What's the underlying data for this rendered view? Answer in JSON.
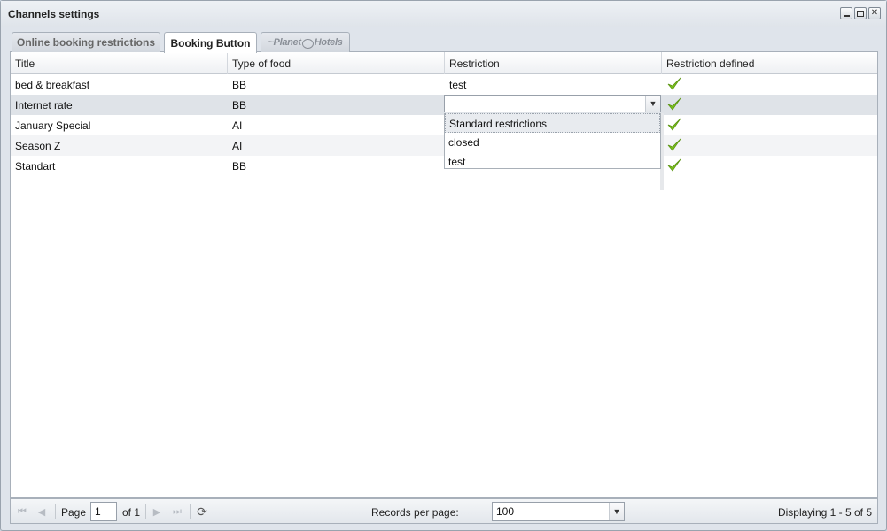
{
  "window": {
    "title": "Channels settings",
    "tools": [
      "minimize-icon",
      "maximize-icon",
      "close-icon"
    ]
  },
  "tabs": [
    {
      "label": "Online booking restrictions",
      "active": false
    },
    {
      "label": "Booking Button",
      "active": true
    },
    {
      "label_left": "~Planet",
      "label_right": "Hotels",
      "icon": "globe-icon",
      "disabled": true
    }
  ],
  "grid": {
    "columns": [
      "Title",
      "Type of food",
      "Restriction",
      "Restriction defined"
    ],
    "rows": [
      {
        "title": "bed & breakfast",
        "food": "BB",
        "restriction": "test",
        "defined": true
      },
      {
        "title": "Internet rate",
        "food": "BB",
        "restriction": "",
        "defined": true
      },
      {
        "title": "January Special",
        "food": "AI",
        "restriction": "",
        "defined": true
      },
      {
        "title": "Season Z",
        "food": "AI",
        "restriction": "",
        "defined": true
      },
      {
        "title": "Standart",
        "food": "BB",
        "restriction": "",
        "defined": true
      }
    ],
    "editor": {
      "value": "",
      "options": [
        "Standard restrictions",
        "closed",
        "test"
      ],
      "highlighted": "Standard restrictions"
    }
  },
  "pager": {
    "page_label": "Page",
    "page_value": "1",
    "of_label": "of 1",
    "records_label": "Records per page:",
    "records_value": "100",
    "display_text": "Displaying 1 - 5 of 5"
  },
  "colors": {
    "check": "#7cc21e",
    "window_bg": "#dfe4eb"
  }
}
